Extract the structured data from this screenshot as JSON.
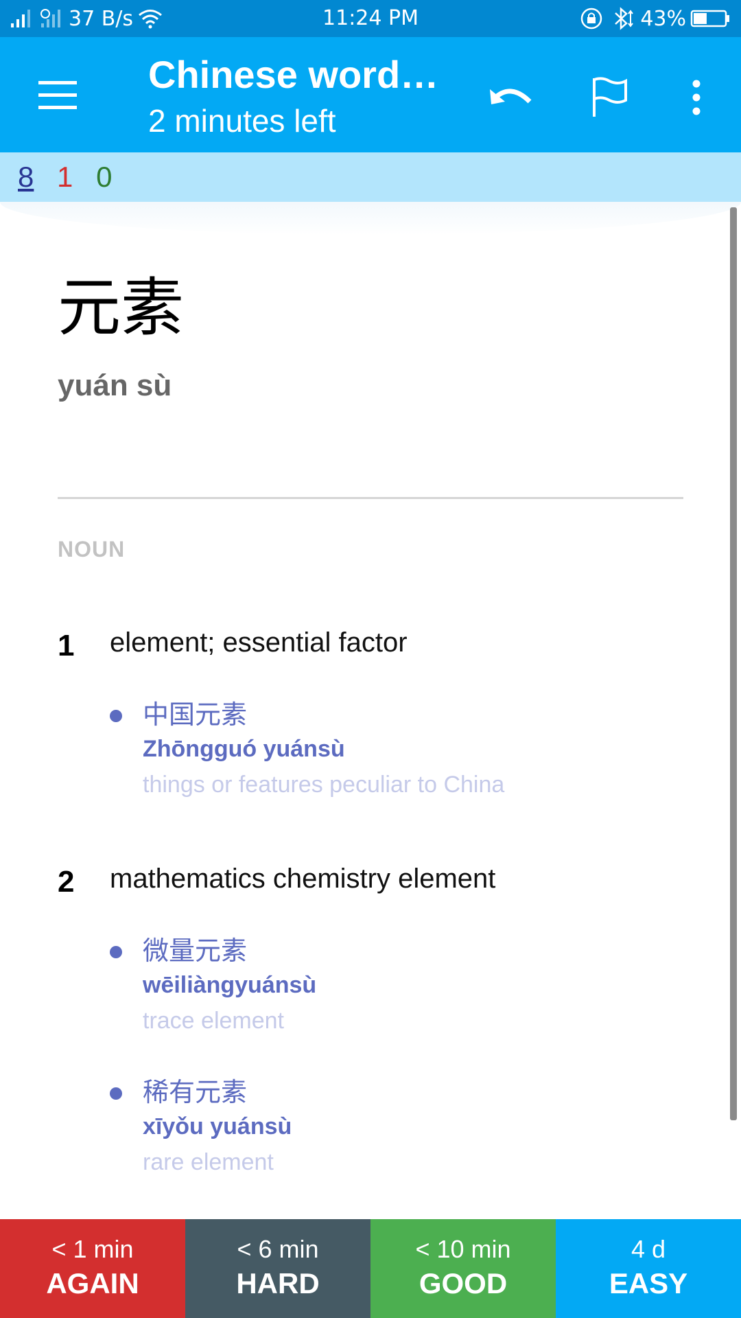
{
  "status_bar": {
    "net_speed": "37 B/s",
    "time": "11:24 PM",
    "battery": "43%",
    "battery_level": 0.43,
    "icons": [
      "signal-icon",
      "signal-icon",
      "wifi-icon",
      "lock-rotation-icon",
      "bluetooth-icon",
      "battery-icon"
    ]
  },
  "app_bar": {
    "title": "Chinese word…",
    "subtitle": "2 minutes left",
    "icons": [
      "menu-icon",
      "undo-icon",
      "flag-icon",
      "more-vert-icon"
    ]
  },
  "counts": {
    "new": "8",
    "learning": "1",
    "review": "0",
    "colors": {
      "new": "#283593",
      "learning": "#d32f2f",
      "review": "#2e7d32"
    }
  },
  "card": {
    "word": "元素",
    "reading": "yuán sù",
    "part_of_speech": "NOUN",
    "senses": [
      {
        "number": "1",
        "definition": "element; essential factor",
        "examples": [
          {
            "hanzi": "中国元素",
            "pinyin": "Zhōngguó yuánsù",
            "gloss": "things or features peculiar to China"
          }
        ]
      },
      {
        "number": "2",
        "definition": "mathematics chemistry element",
        "examples": [
          {
            "hanzi": "微量元素",
            "pinyin": "wēiliàngyuánsù",
            "gloss": "trace element"
          },
          {
            "hanzi": "稀有元素",
            "pinyin": "xīyǒu yuánsù",
            "gloss": "rare element"
          }
        ]
      }
    ]
  },
  "answers": [
    {
      "interval": "< 1 min",
      "label": "AGAIN",
      "color": "#d32f2f"
    },
    {
      "interval": "< 6 min",
      "label": "HARD",
      "color": "#455a64"
    },
    {
      "interval": "< 10 min",
      "label": "GOOD",
      "color": "#4caf50"
    },
    {
      "interval": "4 d",
      "label": "EASY",
      "color": "#03a9f4"
    }
  ]
}
